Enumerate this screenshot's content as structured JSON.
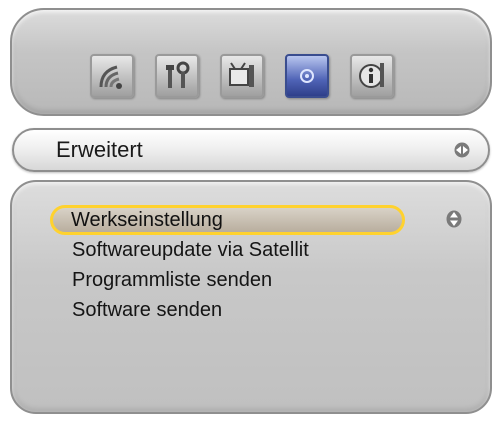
{
  "toolbar": {
    "icons": [
      {
        "name": "reception-icon",
        "active": false
      },
      {
        "name": "tools-icon",
        "active": false
      },
      {
        "name": "tv-settings-icon",
        "active": false
      },
      {
        "name": "advanced-icon",
        "active": true
      },
      {
        "name": "info-icon",
        "active": false
      }
    ]
  },
  "header": {
    "title": "Erweitert",
    "nav_icon": "left-right-arrows-icon"
  },
  "menu": {
    "items": [
      {
        "label": "Werkseinstellung",
        "selected": true
      },
      {
        "label": "Softwareupdate via Satellit",
        "selected": false
      },
      {
        "label": "Programmliste senden",
        "selected": false
      },
      {
        "label": "Software senden",
        "selected": false
      }
    ],
    "scroll_icon": "up-down-arrows-icon"
  },
  "colors": {
    "selection_border": "#ffd22e",
    "active_tab": "#4f63b6",
    "panel": "#c8c8c8"
  }
}
